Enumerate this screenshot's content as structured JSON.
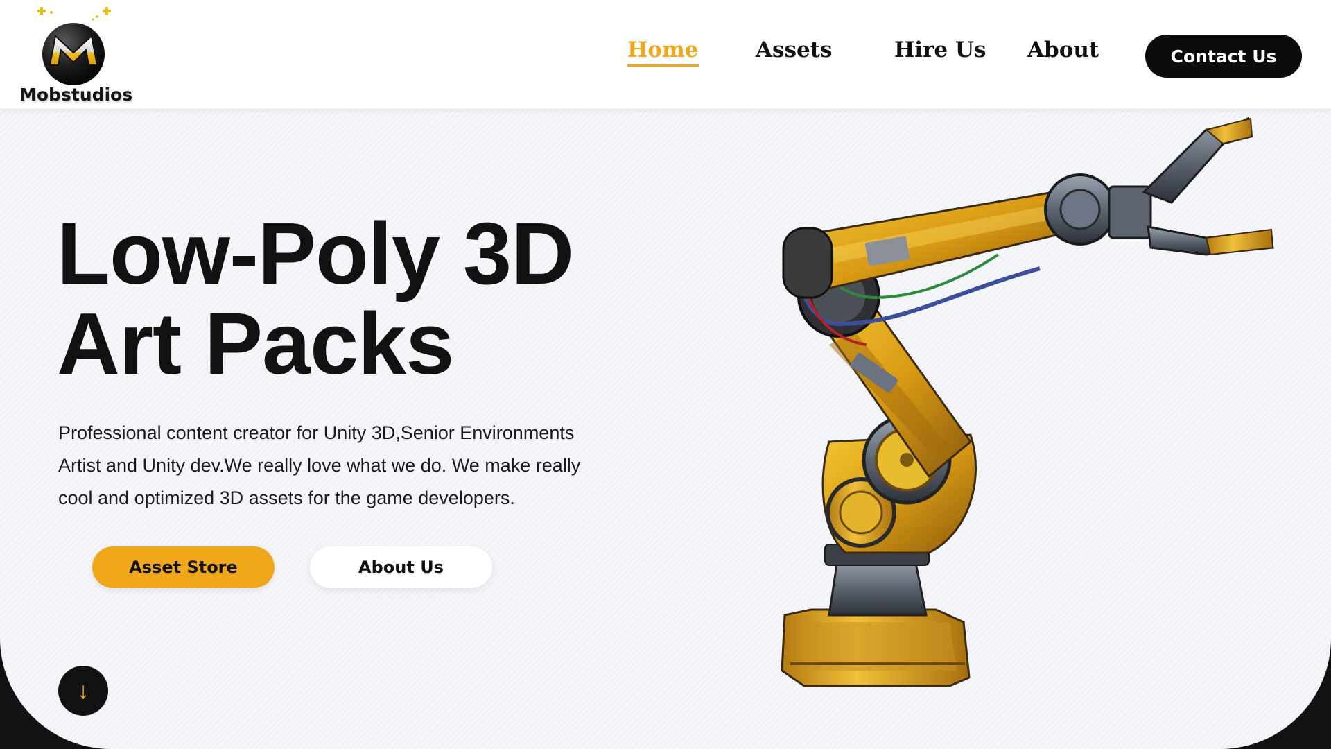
{
  "brand": {
    "name": "Mobstudios",
    "logo_icon": "mobstudios-m-logo",
    "accent": "#f0a81a"
  },
  "nav": {
    "items": [
      {
        "label": "Home",
        "active": true
      },
      {
        "label": "Assets",
        "active": false
      },
      {
        "label": "Hire Us",
        "active": false
      },
      {
        "label": "About",
        "active": false
      }
    ],
    "cta_label": "Contact Us"
  },
  "hero": {
    "title_line1": "Low-Poly 3D",
    "title_line2": "Art Packs",
    "description": "Professional content creator for Unity 3D,Senior Environments Artist and Unity dev.We really love what we do. We make really cool and optimized 3D assets for the game developers.",
    "primary_button": "Asset Store",
    "secondary_button": "About Us",
    "scroll_icon": "arrow-down-icon",
    "scroll_glyph": "↓",
    "image": "yellow-industrial-robot-arm"
  },
  "colors": {
    "accent": "#f0a81a",
    "dark": "#0c0c0c",
    "hero_bg": "#f4f6f9"
  }
}
